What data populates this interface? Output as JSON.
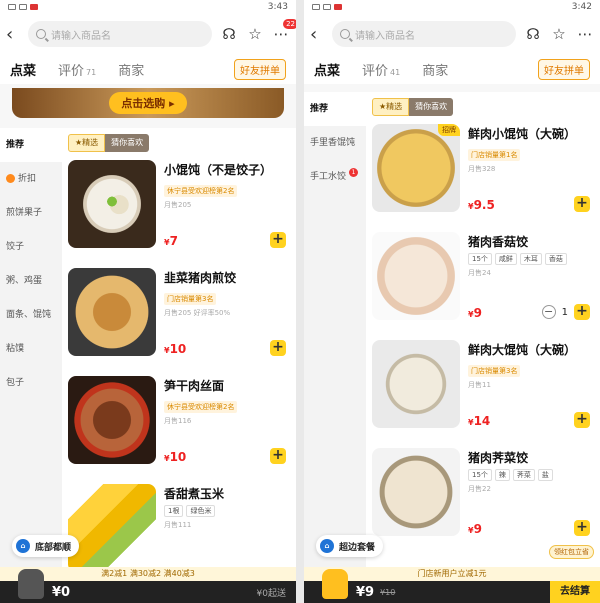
{
  "left": {
    "status_time": "3:43",
    "search_placeholder": "请输入商品名",
    "notif_count": "22",
    "tabs": {
      "order": "点菜",
      "review": "评价",
      "review_count": "71",
      "shop": "商家",
      "friends": "好友拼单"
    },
    "banner_button": "点击选购",
    "sidebar": [
      "推荐",
      "折扣",
      "煎饼果子",
      "饺子",
      "粥、鸡蛋",
      "面条、馄饨",
      "粘馍",
      "包子"
    ],
    "filter": {
      "featured": "精选",
      "guess": "猜你喜欢"
    },
    "dishes": [
      {
        "name": "小馄饨（不是饺子）",
        "rank": "休宁县受欢迎榜第2名",
        "meta": "月售205",
        "price": "7"
      },
      {
        "name": "韭菜猪肉煎饺",
        "rank": "门店销量第3名",
        "meta": "月售205  好评率50%",
        "price": "10"
      },
      {
        "name": "笋干肉丝面",
        "rank": "休宁县受欢迎榜第2名",
        "meta": "月售116",
        "price": "10"
      },
      {
        "name": "香甜煮玉米",
        "tags": [
          "1根",
          "绿色米"
        ],
        "meta": "月售111"
      }
    ],
    "float_card": "底部都顺",
    "promo": "满2减1 满30减2 满40减3",
    "cart_price": "¥0",
    "cart_right": "¥0起送"
  },
  "right": {
    "status_time": "3:42",
    "search_placeholder": "请输入商品名",
    "tabs": {
      "order": "点菜",
      "review": "评价",
      "review_count": "41",
      "shop": "商家",
      "friends": "好友拼单"
    },
    "sidebar": [
      "推荐",
      "手里香馄饨",
      "手工水饺"
    ],
    "sidebar_badge": "1",
    "filter": {
      "featured": "精选",
      "guess": "猜你喜欢"
    },
    "dishes": [
      {
        "name": "鲜肉小馄饨（大碗）",
        "rank": "门店销量第1名",
        "meta": "月售328",
        "price": "9.5",
        "hot": "招牌"
      },
      {
        "name": "猪肉香菇饺",
        "tags": [
          "15个",
          "咸鲜",
          "木耳",
          "香菇"
        ],
        "meta": "月售24",
        "price": "9",
        "qty": "1"
      },
      {
        "name": "鲜肉大馄饨（大碗）",
        "rank": "门店销量第3名",
        "meta": "月售11",
        "price": "14"
      },
      {
        "name": "猪肉荠菜饺",
        "tags": [
          "15个",
          "辣",
          "荠菜",
          "盐"
        ],
        "meta": "月售22",
        "price": "9"
      }
    ],
    "float_card": "超边套餐",
    "promo": "门店新用户立减1元",
    "coupon": "领红包立省",
    "cart_price": "¥9",
    "cart_orig": "¥10",
    "cart_right": "去结算"
  }
}
